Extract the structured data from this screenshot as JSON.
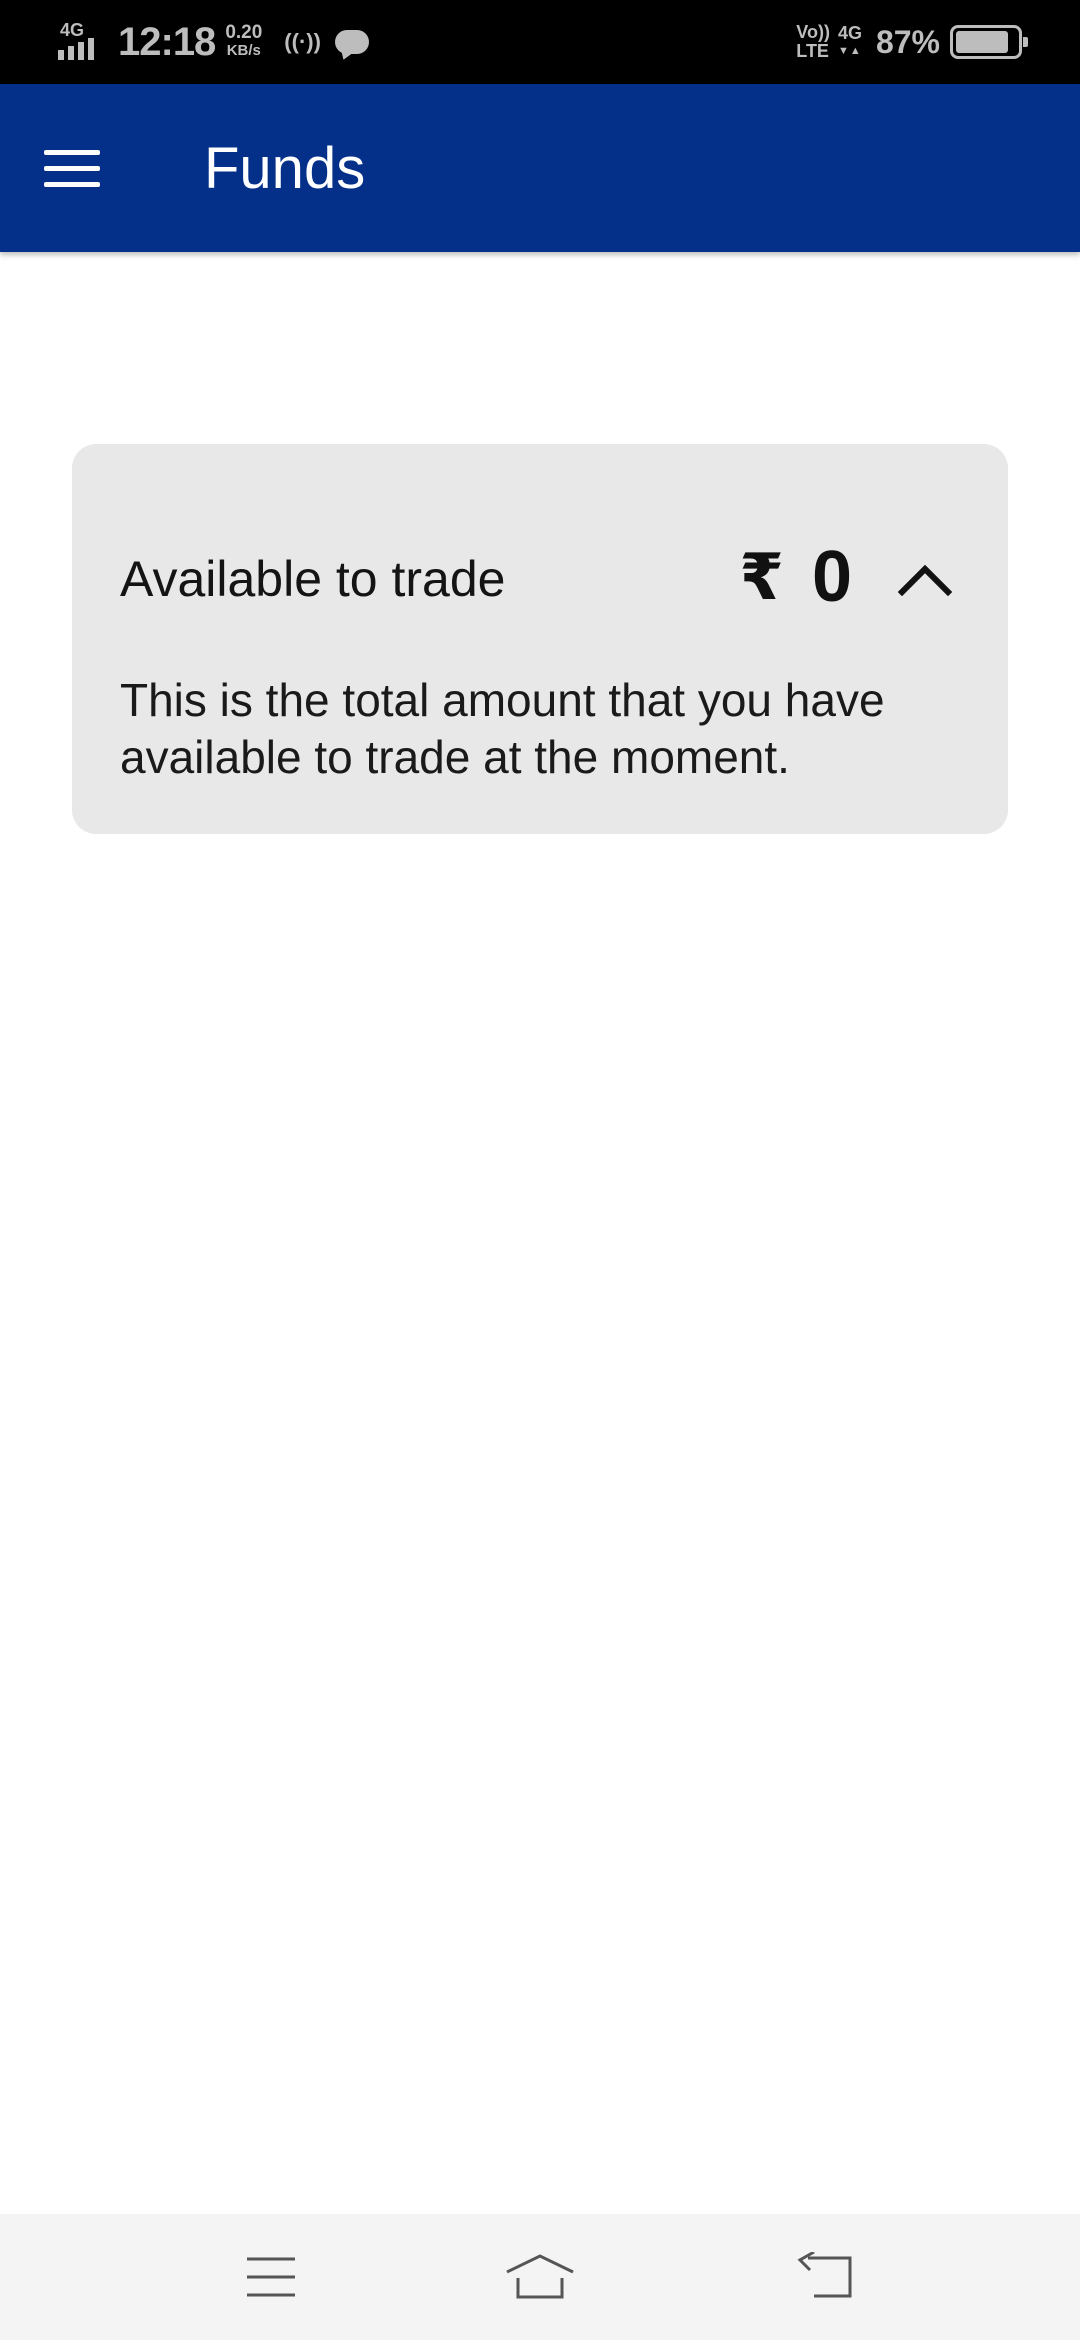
{
  "status_bar": {
    "network_type": "4G",
    "time": "12:18",
    "speed_value": "0.20",
    "speed_unit": "KB/s",
    "hotspot": "((·))",
    "volte_top": "Vo))",
    "volte_bottom": "LTE",
    "network_type_right": "4G",
    "data_arrows": "▼▲",
    "battery_percent": "87%",
    "battery_level": 0.87
  },
  "app_bar": {
    "title": "Funds",
    "menu_icon": "hamburger-menu-icon",
    "background_color": "#05308a"
  },
  "fund_card": {
    "label": "Available to trade",
    "currency_symbol": "₹",
    "amount": "0",
    "toggle_icon": "chevron-up-icon",
    "description": "This is the total amount that you have available to trade at the moment.",
    "background_color": "#e8e8e8"
  },
  "nav_bar": {
    "menu_icon": "recent-apps-menu-icon",
    "home_icon": "home-icon",
    "back_icon": "back-icon"
  }
}
